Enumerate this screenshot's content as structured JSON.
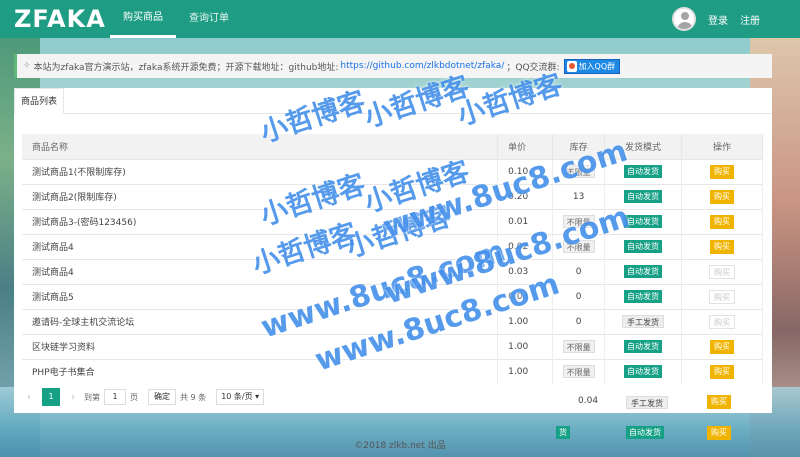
{
  "header": {
    "logo": "ZFAKA",
    "nav": [
      {
        "label": "购买商品",
        "active": true
      },
      {
        "label": "查询订单",
        "active": false
      }
    ],
    "login": "登录",
    "register": "注册",
    "accent_color": "#1f9c84"
  },
  "notice": {
    "text_before": "本站为zfaka官方演示站，zfaka系统开源免费；开源下载地址：github地址:",
    "link": "https://github.com/zlkbdotnet/zfaka/",
    "text_after": "；QQ交流群:",
    "qq_button": "加入QQ群"
  },
  "panel": {
    "tab": "商品列表",
    "headers": {
      "name": "商品名称",
      "price": "单价",
      "stock": "库存",
      "mode": "发货模式",
      "action": "操作"
    },
    "rows": [
      {
        "name": "测试商品1(不限制库存)",
        "price": "0.10",
        "stock": "不限量",
        "stock_tag": true,
        "mode": "自动发货",
        "mode_auto": true,
        "action": "购买",
        "disabled": false
      },
      {
        "name": "测试商品2(限制库存)",
        "price": "0.20",
        "stock": "13",
        "stock_tag": false,
        "mode": "自动发货",
        "mode_auto": true,
        "action": "购买",
        "disabled": false
      },
      {
        "name": "测试商品3-(密码123456)",
        "price": "0.01",
        "stock": "不限量",
        "stock_tag": true,
        "mode": "自动发货",
        "mode_auto": true,
        "action": "购买",
        "disabled": false
      },
      {
        "name": "测试商品4",
        "price": "0.02",
        "stock": "不限量",
        "stock_tag": true,
        "mode": "自动发货",
        "mode_auto": true,
        "action": "购买",
        "disabled": false
      },
      {
        "name": "测试商品4",
        "price": "0.03",
        "stock": "0",
        "stock_tag": false,
        "mode": "自动发货",
        "mode_auto": true,
        "action": "购买",
        "disabled": true
      },
      {
        "name": "测试商品5",
        "price": "0.04",
        "stock": "0",
        "stock_tag": false,
        "mode": "自动发货",
        "mode_auto": true,
        "action": "购买",
        "disabled": true
      },
      {
        "name": "邀请码-全球主机交流论坛",
        "price": "1.00",
        "stock": "0",
        "stock_tag": false,
        "mode": "手工发货",
        "mode_auto": false,
        "action": "购买",
        "disabled": true
      },
      {
        "name": "区块链学习资料",
        "price": "1.00",
        "stock": "不限量",
        "stock_tag": true,
        "mode": "自动发货",
        "mode_auto": true,
        "action": "购买",
        "disabled": false
      },
      {
        "name": "PHP电子书集合",
        "price": "1.00",
        "stock": "不限量",
        "stock_tag": true,
        "mode": "自动发货",
        "mode_auto": true,
        "action": "购买",
        "disabled": false
      }
    ],
    "pager": {
      "prev": "‹",
      "current": "1",
      "next": "›",
      "goto_label": "到第",
      "goto_value": "1",
      "page_unit": "页",
      "confirm": "确定",
      "total": "共 9 条",
      "page_size": "10 条/页"
    }
  },
  "spill": {
    "price": "0.04",
    "mode1": "手工发货",
    "action1": "购买",
    "mode2": "自动发货",
    "action2": "购买",
    "fragment": "货"
  },
  "watermark": {
    "line1": "小哲博客",
    "line2": "小哲博客",
    "line3": "小哲博客",
    "line4": "小哲博客",
    "line5": "小哲博客",
    "line6": "小哲博客",
    "line7": "小哲博客",
    "url1": "www.8uc8.com",
    "url2": "www.8uc8.com",
    "url3": "www.8uc8.com",
    "url4": "www.8uc8.com"
  },
  "footer": "©2018 zlkb.net 出品"
}
